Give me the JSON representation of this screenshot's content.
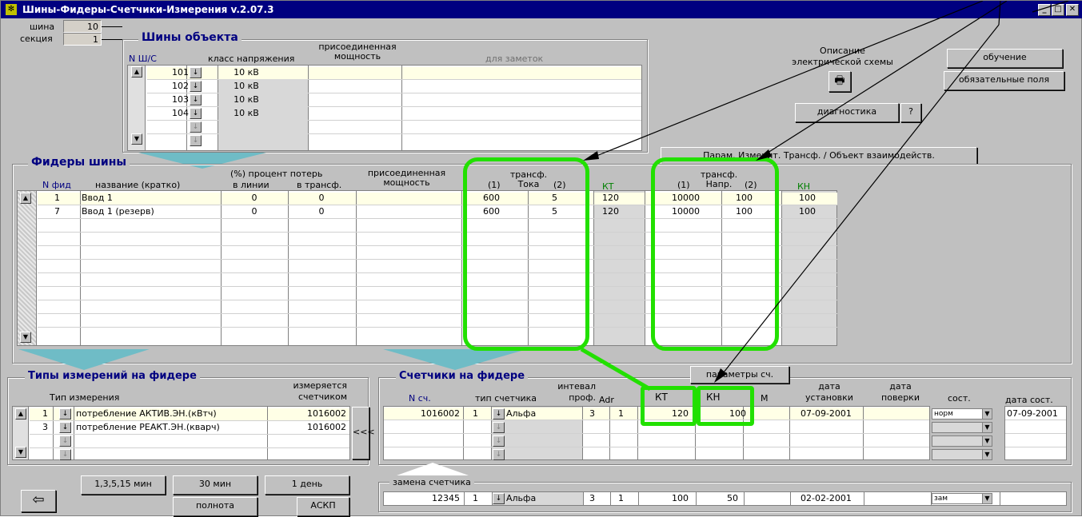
{
  "window": {
    "title": "Шины-Фидеры-Счетчики-Измерения   v.2.07.3"
  },
  "top": {
    "bus_label": "шина",
    "bus_value": "10",
    "section_label": "секция",
    "section_value": "1"
  },
  "buses": {
    "title": "Шины объекта",
    "headers": {
      "num": "N Ш/С",
      "voltage": "класс напряжения",
      "power": "присоединенная мощность",
      "notes": "для заметок"
    },
    "rows": [
      {
        "num": "101",
        "voltage": "10 кВ"
      },
      {
        "num": "102",
        "voltage": "10 кВ"
      },
      {
        "num": "103",
        "voltage": "10 кВ"
      },
      {
        "num": "104",
        "voltage": "10 кВ"
      }
    ]
  },
  "scheme": {
    "label": "Описание электрической схемы"
  },
  "buttons": {
    "training": "обучение",
    "required": "обязательные поля",
    "diagnostics": "диагностика",
    "help": "?",
    "params": "Парам. Измерит. Трансф.  /  Объект взаимодейств.",
    "meter_params": "параметры сч.",
    "interval1": "1,3,5,15 мин",
    "interval2": "30 мин",
    "interval3": "1 день",
    "completeness": "полнота",
    "askp": "АСКП",
    "transfer": "<<<"
  },
  "feeders": {
    "title": "Фидеры шины",
    "headers": {
      "num": "N фид",
      "name": "название (кратко)",
      "loss_title": "(%) процент потерь",
      "loss_line": "в линии",
      "loss_trans": "в трансф.",
      "power": "присоединенная мощность",
      "ct_title": "трансф. Тока",
      "ct1": "(1)",
      "ct2": "(2)",
      "kt": "КТ",
      "vt_title": "трансф. Напр.",
      "vt1": "(1)",
      "vt2": "(2)",
      "kn": "КН"
    },
    "rows": [
      {
        "num": "1",
        "name": "Ввод 1",
        "loss_line": "0",
        "loss_trans": "0",
        "ct1": "600",
        "ct2": "5",
        "kt": "120",
        "vt1": "10000",
        "vt2": "100",
        "kn": "100"
      },
      {
        "num": "7",
        "name": "Ввод 1 (резерв)",
        "loss_line": "0",
        "loss_trans": "0",
        "ct1": "600",
        "ct2": "5",
        "kt": "120",
        "vt1": "10000",
        "vt2": "100",
        "kn": "100"
      }
    ]
  },
  "measurements": {
    "title": "Типы измерений на фидере",
    "headers": {
      "type": "Тип измерения",
      "meter": "измеряется счетчиком"
    },
    "rows": [
      {
        "num": "1",
        "type": "потребление АКТИВ.ЭН.(кВтч)",
        "meter": "1016002"
      },
      {
        "num": "3",
        "type": "потребление РЕАКТ.ЭН.(кварч)",
        "meter": "1016002"
      }
    ]
  },
  "meters": {
    "title": "Счетчики на фидере",
    "headers": {
      "num": "N сч.",
      "type": "тип счетчика",
      "interval": "интевал проф.",
      "adr": "Adr",
      "kt": "КТ",
      "kn": "КН",
      "m": "М",
      "install": "дата установки",
      "verify": "дата поверки",
      "state": "сост.",
      "state_date": "дата сост."
    },
    "rows": [
      {
        "num": "1016002",
        "t": "1",
        "type": "Альфа",
        "interval": "3",
        "adr": "1",
        "kt": "120",
        "kn": "100",
        "install": "07-09-2001",
        "state": "норм",
        "state_date": "07-09-2001"
      }
    ]
  },
  "replacement": {
    "title": "замена счетчика",
    "num": "12345",
    "t": "1",
    "type": "Альфа",
    "interval": "3",
    "adr": "1",
    "kt": "100",
    "kn": "50",
    "install": "02-02-2001",
    "state": "зам"
  }
}
